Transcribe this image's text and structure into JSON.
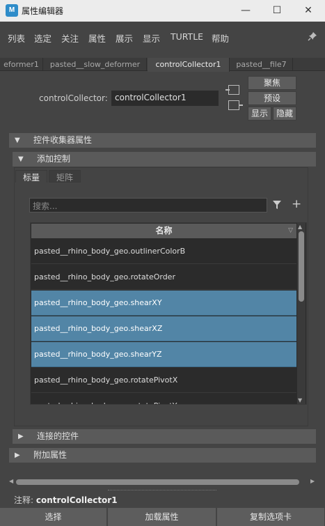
{
  "window": {
    "app_icon": "M",
    "title": "属性编辑器",
    "minimize": "—",
    "maximize": "☐",
    "close": "✕"
  },
  "menu": {
    "items": [
      "列表",
      "选定",
      "关注",
      "属性",
      "展示",
      "显示",
      "TURTLE",
      "帮助"
    ],
    "pin_icon": "pin-icon"
  },
  "tabs": [
    {
      "label": "eformer1",
      "active": false
    },
    {
      "label": "pasted__slow_deformer",
      "active": false
    },
    {
      "label": "controlCollector1",
      "active": true
    },
    {
      "label": "pasted__file7",
      "active": false
    }
  ],
  "node": {
    "label": "controlCollector:",
    "value": "controlCollector1",
    "buttons": {
      "focus": "聚焦",
      "presets": "预设",
      "show": "显示",
      "hide": "隐藏"
    }
  },
  "sections": {
    "attrs": "控件收集器属性",
    "add_control": "添加控制",
    "connected": "连接的控件",
    "extra": "附加属性"
  },
  "subtabs": [
    "标量",
    "矩阵"
  ],
  "search": {
    "placeholder": "搜索..."
  },
  "list": {
    "header": "名称",
    "rows": [
      {
        "label": "pasted__rhino_body_geo.outlinerColorB",
        "selected": false
      },
      {
        "label": "pasted__rhino_body_geo.rotateOrder",
        "selected": false
      },
      {
        "label": "pasted__rhino_body_geo.shearXY",
        "selected": true
      },
      {
        "label": "pasted__rhino_body_geo.shearXZ",
        "selected": true
      },
      {
        "label": "pasted__rhino_body_geo.shearYZ",
        "selected": true
      },
      {
        "label": "pasted__rhino_body_geo.rotatePivotX",
        "selected": false
      },
      {
        "label": "pasted__rhino_body_geo.rotatePivotY",
        "selected": false
      }
    ]
  },
  "footer": {
    "notes_label": "注释:",
    "notes_value": "controlCollector1",
    "buttons": [
      "选择",
      "加载属性",
      "复制选项卡"
    ]
  },
  "colors": {
    "selection": "#5285a6",
    "panel": "#444444",
    "section": "#5a5a5a",
    "field": "#2b2b2b"
  }
}
